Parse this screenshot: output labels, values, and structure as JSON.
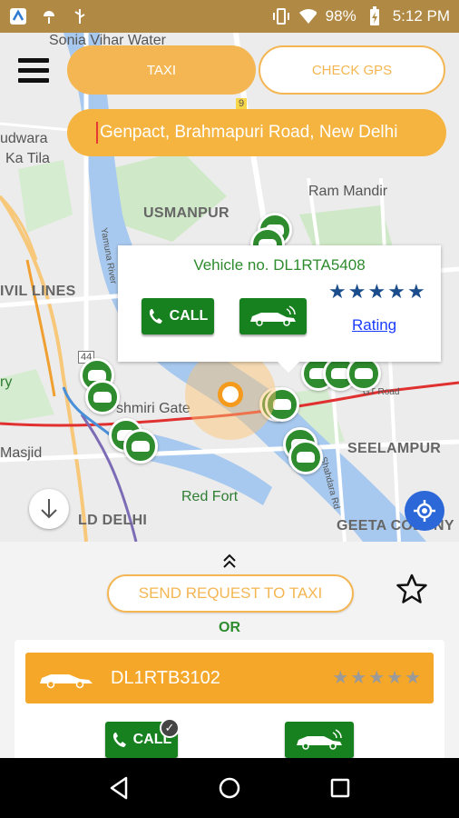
{
  "status_bar": {
    "battery": "98%",
    "time": "5:12 PM",
    "icons": [
      "app-icon",
      "android-icon",
      "usb-icon",
      "vibrate-icon",
      "wifi-icon",
      "battery-icon"
    ]
  },
  "map": {
    "labels": {
      "sonia_vihar": "Sonia Vihar Water",
      "udwara": "udwara",
      "ka_tila": "Ka Tila",
      "usmanpur": "USMANPUR",
      "ram_mandir": "Ram Mandir",
      "civil_lines": "IVIL LINES",
      "ry": "ry",
      "kashmiri_gate": "shmiri Gate",
      "masjid": "Masjid",
      "seelampur": "SEELAMPUR",
      "red_fort": "Red Fort",
      "old_delhi": "LD DELHI",
      "geeta_colony": "GEETA COLONY",
      "gt_road": "GT Road",
      "yamuna_river": "Yamuna River",
      "shahdara": "Shahdara Rd",
      "road_44": "44",
      "road_9": "9"
    }
  },
  "tabs": {
    "taxi": "TAXI",
    "check_gps": "CHECK GPS"
  },
  "search": {
    "value": "Genpact, Brahmapuri Road, New Delhi"
  },
  "popup": {
    "vehicle_no": "Vehicle no. DL1RTA5408",
    "call": "CALL",
    "rating_link": "Rating",
    "rating_value": 5
  },
  "panel": {
    "send_request": "SEND REQUEST TO TAXI",
    "or": "OR",
    "vehicle": "DL1RTB3102",
    "vehicle_rating": 0,
    "call": "CALL"
  },
  "colors": {
    "accent": "#f4b652",
    "green": "#17801f",
    "blue_button": "#2d68d8"
  }
}
